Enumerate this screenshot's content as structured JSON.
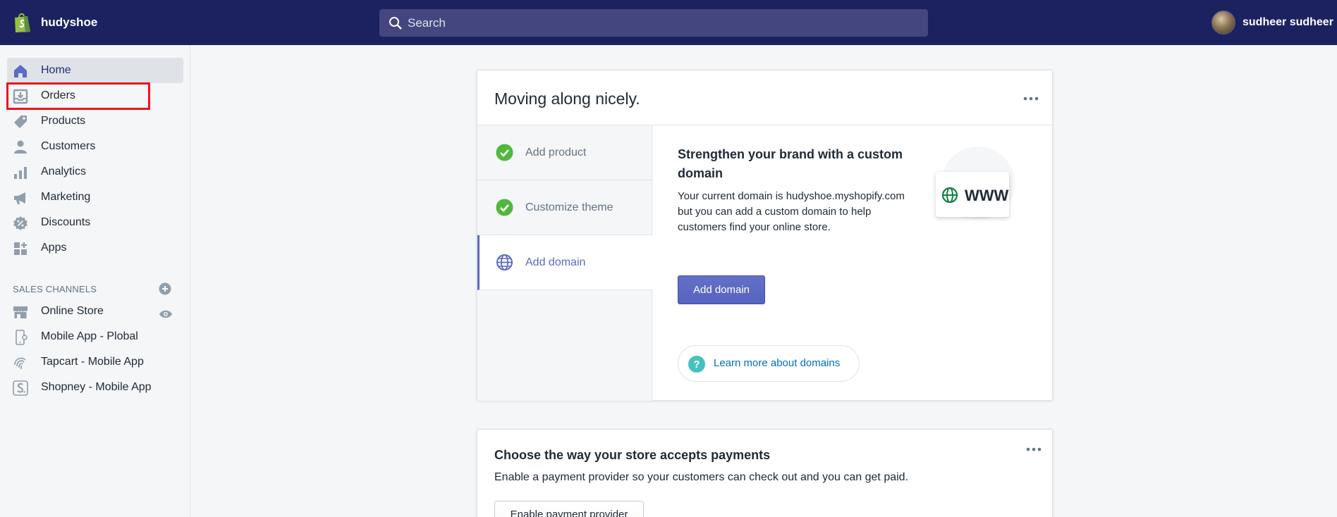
{
  "topbar": {
    "store_name": "hudyshoe",
    "search_placeholder": "Search",
    "username": "sudheer sudheer"
  },
  "sidebar": {
    "items": [
      {
        "label": "Home",
        "icon": "home-icon",
        "active": true
      },
      {
        "label": "Orders",
        "icon": "orders-icon"
      },
      {
        "label": "Products",
        "icon": "tag-icon"
      },
      {
        "label": "Customers",
        "icon": "person-icon"
      },
      {
        "label": "Analytics",
        "icon": "bar-chart-icon"
      },
      {
        "label": "Marketing",
        "icon": "megaphone-icon"
      },
      {
        "label": "Discounts",
        "icon": "discount-icon"
      },
      {
        "label": "Apps",
        "icon": "apps-icon"
      }
    ],
    "sales_channels_title": "SALES CHANNELS",
    "channels": [
      {
        "label": "Online Store",
        "icon": "store-icon"
      },
      {
        "label": "Mobile App - Plobal",
        "icon": "mobile-icon"
      },
      {
        "label": "Tapcart - Mobile App",
        "icon": "tapcart-icon"
      },
      {
        "label": "Shopney - Mobile App",
        "icon": "shopney-icon"
      }
    ]
  },
  "setup_card": {
    "title": "Moving along nicely.",
    "steps": [
      {
        "label": "Add product",
        "status": "done"
      },
      {
        "label": "Customize theme",
        "status": "done"
      },
      {
        "label": "Add domain",
        "status": "active"
      }
    ],
    "detail_title": "Strengthen your brand with a custom domain",
    "detail_desc": "Your current domain is hudyshoe.myshopify.com but you can add a custom domain to help customers find your online store.",
    "illustration_text": "WWW",
    "primary_button": "Add domain",
    "learn_more": "Learn more about domains"
  },
  "payments_card": {
    "title": "Choose the way your store accepts payments",
    "desc": "Enable a payment provider so your customers can check out and you can get paid.",
    "button": "Enable payment provider"
  },
  "colors": {
    "topbar": "#1c2260",
    "accent": "#5c6ac4",
    "success": "#50b83c",
    "highlight": "#e8171d",
    "link": "#006fbb"
  }
}
